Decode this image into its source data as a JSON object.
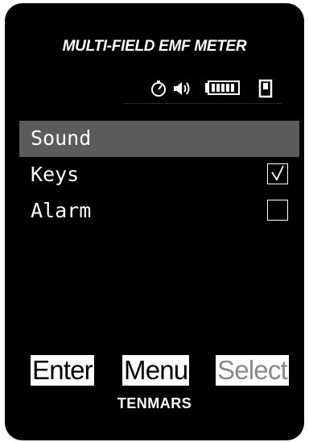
{
  "header": {
    "title": "MULTI-FIELD EMF METER"
  },
  "status_icons": [
    "timer-icon",
    "speaker-icon",
    "battery-icon",
    "device-icon"
  ],
  "menu": {
    "items": [
      {
        "label": "Sound",
        "selected": true
      },
      {
        "label": "Keys",
        "checked": true
      },
      {
        "label": "Alarm",
        "checked": false
      }
    ]
  },
  "softkeys": {
    "enter": "Enter",
    "menu": "Menu",
    "select": "Select"
  },
  "brand": "TENMARS",
  "colors": {
    "background": "#000000",
    "selection": "#5b5b5b",
    "text": "#ffffff",
    "dim_key_text": "#8a8a8a"
  }
}
